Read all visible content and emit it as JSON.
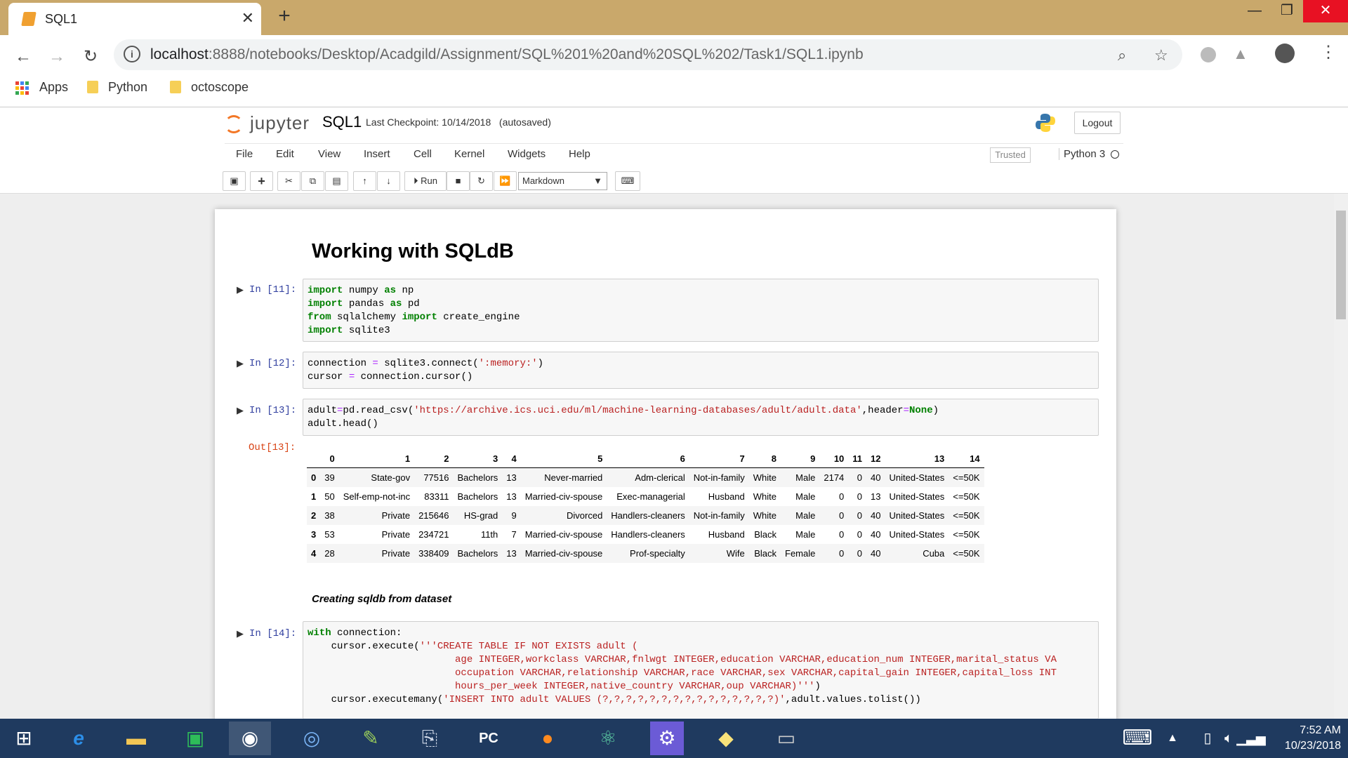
{
  "browser": {
    "tab_title": "SQL1",
    "new_tab": "+",
    "url_host": "localhost",
    "url_rest": ":8888/notebooks/Desktop/Acadgild/Assignment/SQL%201%20and%20SQL%202/Task1/SQL1.ipynb",
    "bookmarks": [
      "Apps",
      "Python",
      "octoscope"
    ]
  },
  "jupyter": {
    "logo": "jupyter",
    "notebook_name": "SQL1",
    "checkpoint": "Last Checkpoint: 10/14/2018",
    "autosaved": "(autosaved)",
    "logout": "Logout",
    "menu": [
      "File",
      "Edit",
      "View",
      "Insert",
      "Cell",
      "Kernel",
      "Widgets",
      "Help"
    ],
    "trusted": "Trusted",
    "kernel": "Python 3",
    "run_label": "Run",
    "cell_type": "Markdown"
  },
  "notebook": {
    "heading": "Working with SQLdB",
    "prompts": [
      "In [11]:",
      "In [12]:",
      "In [13]:",
      "Out[13]:",
      "In [14]:"
    ],
    "subheading": "Creating sqldb from dataset"
  },
  "dataframe": {
    "columns": [
      "",
      "0",
      "1",
      "2",
      "3",
      "4",
      "5",
      "6",
      "7",
      "8",
      "9",
      "10",
      "11",
      "12",
      "13",
      "14"
    ],
    "rows": [
      [
        "0",
        "39",
        "State-gov",
        "77516",
        "Bachelors",
        "13",
        "Never-married",
        "Adm-clerical",
        "Not-in-family",
        "White",
        "Male",
        "2174",
        "0",
        "40",
        "United-States",
        "<=50K"
      ],
      [
        "1",
        "50",
        "Self-emp-not-inc",
        "83311",
        "Bachelors",
        "13",
        "Married-civ-spouse",
        "Exec-managerial",
        "Husband",
        "White",
        "Male",
        "0",
        "0",
        "13",
        "United-States",
        "<=50K"
      ],
      [
        "2",
        "38",
        "Private",
        "215646",
        "HS-grad",
        "9",
        "Divorced",
        "Handlers-cleaners",
        "Not-in-family",
        "White",
        "Male",
        "0",
        "0",
        "40",
        "United-States",
        "<=50K"
      ],
      [
        "3",
        "53",
        "Private",
        "234721",
        "11th",
        "7",
        "Married-civ-spouse",
        "Handlers-cleaners",
        "Husband",
        "Black",
        "Male",
        "0",
        "0",
        "40",
        "United-States",
        "<=50K"
      ],
      [
        "4",
        "28",
        "Private",
        "338409",
        "Bachelors",
        "13",
        "Married-civ-spouse",
        "Prof-specialty",
        "Wife",
        "Black",
        "Female",
        "0",
        "0",
        "40",
        "Cuba",
        "<=50K"
      ]
    ]
  },
  "taskbar": {
    "time": "7:52 AM",
    "date": "10/23/2018"
  },
  "colors": {
    "tabbar": "#c9a86b",
    "jupyter_orange": "#f37726",
    "prompt_in": "#303f9f",
    "prompt_out": "#d84315",
    "taskbar": "#1f3a5f"
  }
}
